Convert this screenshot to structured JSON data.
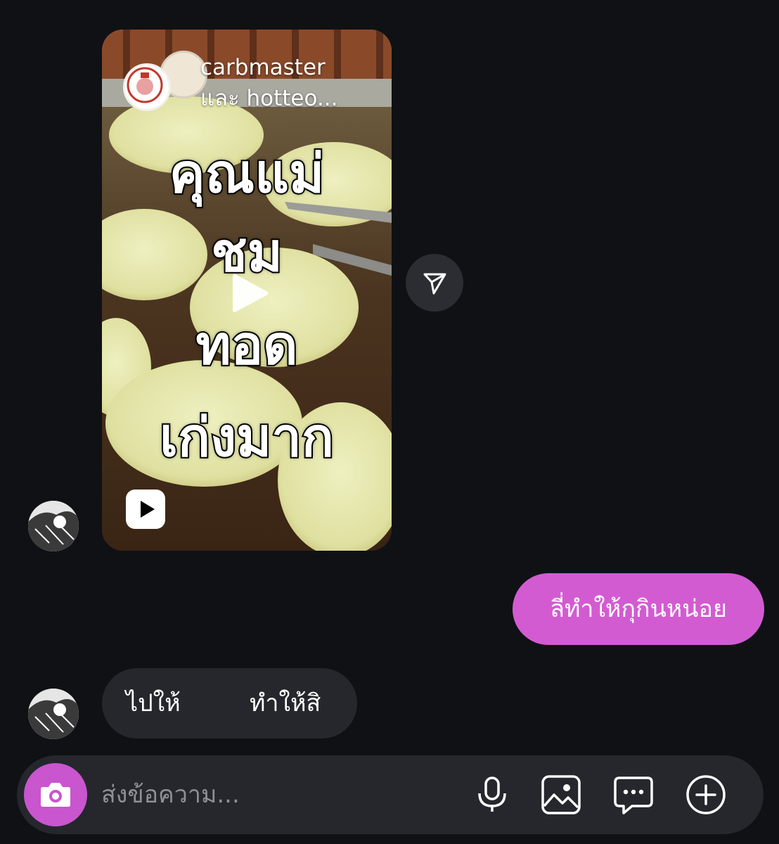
{
  "reel": {
    "owner": "carbmaster",
    "collab": "และ hotteo...",
    "caption_lines": [
      "คุณแม่",
      "ชม",
      "ทอด",
      "เก่งมาก"
    ]
  },
  "messages": {
    "outgoing": "ลี่ทำให้กุกินหน่อย",
    "incoming_left": "ไปให้",
    "incoming_right": "ทำให้สิ"
  },
  "composer": {
    "placeholder": "ส่งข้อความ..."
  },
  "icons": {
    "share": "paper-plane-icon",
    "play": "play-icon",
    "reels": "reels-icon",
    "camera": "camera-icon",
    "mic": "microphone-icon",
    "gallery": "image-icon",
    "sticker": "chat-bubble-icon",
    "more": "plus-circle-icon"
  },
  "colors": {
    "background": "#0f1115",
    "outgoing_bubble": "#d35bd2",
    "incoming_bubble": "#25272c",
    "camera_button": "#c955cf"
  }
}
